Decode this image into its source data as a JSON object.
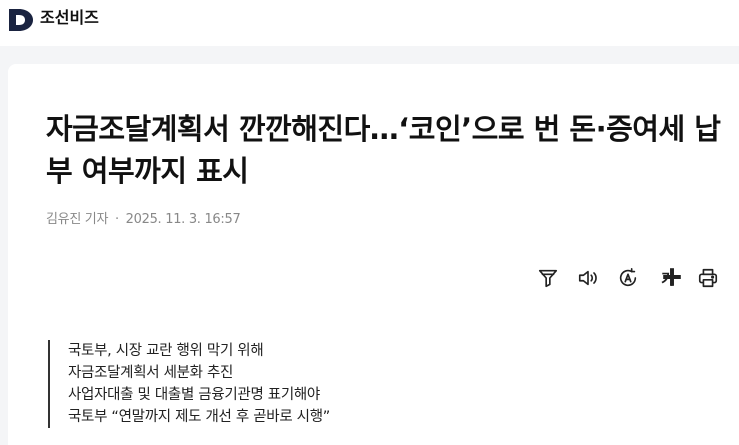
{
  "site": {
    "brand": "조선비즈",
    "logo_icon": "chosunbiz-d-logo-icon"
  },
  "article": {
    "headline": "자금조달계획서 깐깐해진다…‘코인’으로 번 돈·증여세 납부 여부까지 표시",
    "reporter": "김유진 기자",
    "separator": "·",
    "date": "2025. 11. 3. 16:57",
    "summary": [
      "국토부, 시장 교란 행위 막기 위해",
      "자금조달계획서 세분화 추진",
      "사업자대출 및 대출별 금융기관명 표기해야",
      "국토부 “연말까지 제도 개선 후 곧바로 시행”"
    ]
  },
  "toolbar": {
    "icons": [
      "filter-icon",
      "speaker-icon",
      "translate-icon",
      "font-size-icon",
      "print-icon"
    ],
    "font_size_label": "가"
  },
  "colors": {
    "brand": "#1a2340",
    "text": "#111111",
    "meta": "#888888",
    "background": "#f4f5f7"
  }
}
